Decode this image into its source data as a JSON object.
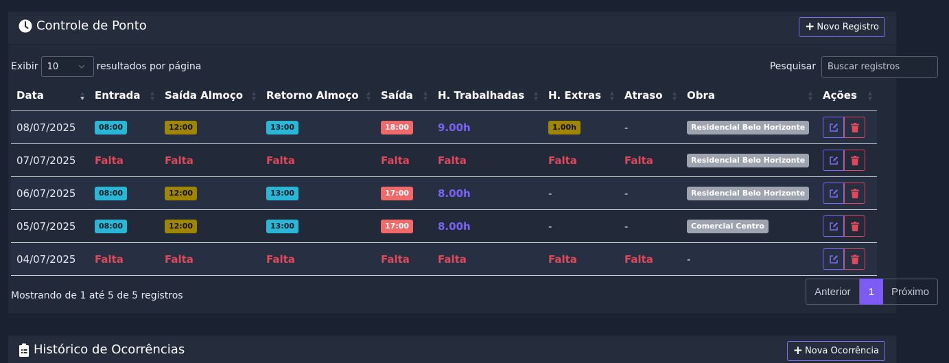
{
  "ponto": {
    "title": "Controle de Ponto",
    "new_label": "Novo Registro",
    "show_prefix": "Exibir",
    "page_size": "10",
    "show_suffix": "resultados por página",
    "search_label": "Pesquisar",
    "search_placeholder": "Buscar registros",
    "columns": [
      "Data",
      "Entrada",
      "Saída Almoço",
      "Retorno Almoço",
      "Saída",
      "H. Trabalhadas",
      "H. Extras",
      "Atraso",
      "Obra",
      "Ações"
    ],
    "rows": [
      {
        "data": "08/07/2025",
        "entrada": "08:00",
        "saida_almoco": "12:00",
        "retorno": "13:00",
        "saida": "18:00",
        "trabalhadas": "9.00h",
        "extras": "1.00h",
        "atraso": "-",
        "obra": "Residencial Belo Horizonte"
      },
      {
        "data": "07/07/2025",
        "entrada": "Falta",
        "saida_almoco": "Falta",
        "retorno": "Falta",
        "saida": "Falta",
        "trabalhadas": "Falta",
        "extras": "Falta",
        "atraso": "Falta",
        "obra": "Residencial Belo Horizonte"
      },
      {
        "data": "06/07/2025",
        "entrada": "08:00",
        "saida_almoco": "12:00",
        "retorno": "13:00",
        "saida": "17:00",
        "trabalhadas": "8.00h",
        "extras": "-",
        "atraso": "-",
        "obra": "Residencial Belo Horizonte"
      },
      {
        "data": "05/07/2025",
        "entrada": "08:00",
        "saida_almoco": "12:00",
        "retorno": "13:00",
        "saida": "17:00",
        "trabalhadas": "8.00h",
        "extras": "-",
        "atraso": "-",
        "obra": "Comercial Centro"
      },
      {
        "data": "04/07/2025",
        "entrada": "Falta",
        "saida_almoco": "Falta",
        "retorno": "Falta",
        "saida": "Falta",
        "trabalhadas": "Falta",
        "extras": "Falta",
        "atraso": "Falta",
        "obra": "-"
      }
    ],
    "info": "Mostrando de 1 até 5 de 5 registros",
    "pager": {
      "prev": "Anterior",
      "page": "1",
      "next": "Próximo"
    }
  },
  "ocorrencias": {
    "title": "Histórico de Ocorrências",
    "new_label": "Nova Ocorrência"
  },
  "colors": {
    "accent": "#7c5cf5",
    "falta": "#e0485a",
    "cyan": "#2ab7d6",
    "olive": "#a08600",
    "salmon": "#f06a6a"
  },
  "icons": [
    "clock-icon",
    "plus-icon",
    "chevron-down-icon",
    "sort-icon",
    "edit-icon",
    "trash-icon",
    "clipboard-icon"
  ]
}
